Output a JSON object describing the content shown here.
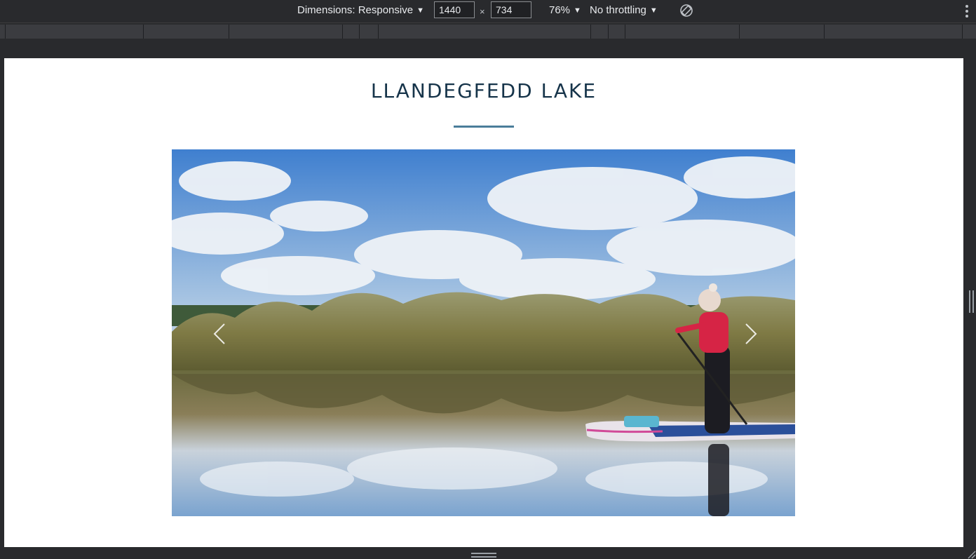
{
  "toolbar": {
    "dimensions_label": "Dimensions: Responsive",
    "width_value": "1440",
    "height_value": "734",
    "times_symbol": "×",
    "zoom_label": "76%",
    "throttling_label": "No throttling"
  },
  "page": {
    "title": "LLANDEGFEDD LAKE"
  },
  "carousel": {
    "prev_icon": "chevron-left-icon",
    "next_icon": "chevron-right-icon"
  },
  "colors": {
    "title": "#16344a",
    "rule": "#4a7d9a",
    "devtools_bg": "#292a2d"
  }
}
